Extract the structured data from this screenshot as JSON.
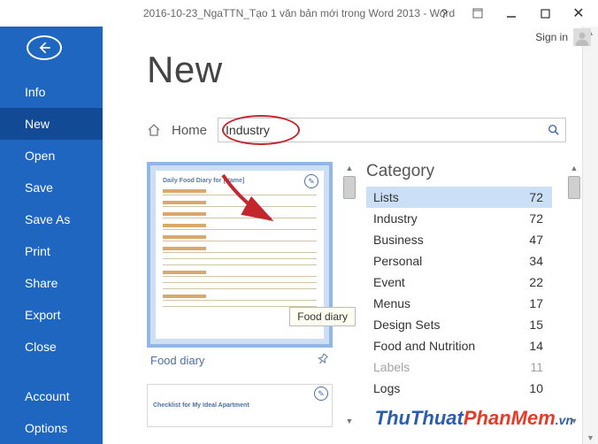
{
  "titlebar": {
    "title": "2016-10-23_NgaTTN_Tạo 1 văn bản mới trong Word 2013 - Word",
    "help": "?",
    "signin": "Sign in"
  },
  "sidebar": {
    "items": [
      {
        "label": "Info"
      },
      {
        "label": "New"
      },
      {
        "label": "Open"
      },
      {
        "label": "Save"
      },
      {
        "label": "Save As"
      },
      {
        "label": "Print"
      },
      {
        "label": "Share"
      },
      {
        "label": "Export"
      },
      {
        "label": "Close"
      }
    ],
    "bottom": [
      {
        "label": "Account"
      },
      {
        "label": "Options"
      }
    ]
  },
  "main": {
    "heading": "New",
    "breadcrumb_home": "Home",
    "search_value": "Industry"
  },
  "templates": {
    "item1_caption": "Food diary",
    "item1_tooltip": "Food diary",
    "item1_doc_title": "Daily Food Diary for [Name]",
    "item2_doc_title": "Checklist for My Ideal Apartment"
  },
  "categories": {
    "heading": "Category",
    "items": [
      {
        "name": "Lists",
        "count": 72
      },
      {
        "name": "Industry",
        "count": 72
      },
      {
        "name": "Business",
        "count": 47
      },
      {
        "name": "Personal",
        "count": 34
      },
      {
        "name": "Event",
        "count": 22
      },
      {
        "name": "Menus",
        "count": 17
      },
      {
        "name": "Design Sets",
        "count": 15
      },
      {
        "name": "Food and Nutrition",
        "count": 14
      },
      {
        "name": "Labels",
        "count": 11
      },
      {
        "name": "Logs",
        "count": 10
      }
    ]
  },
  "watermark": {
    "t1": "ThuThuat",
    "t2": "PhanMem",
    "ext": ".vn"
  }
}
